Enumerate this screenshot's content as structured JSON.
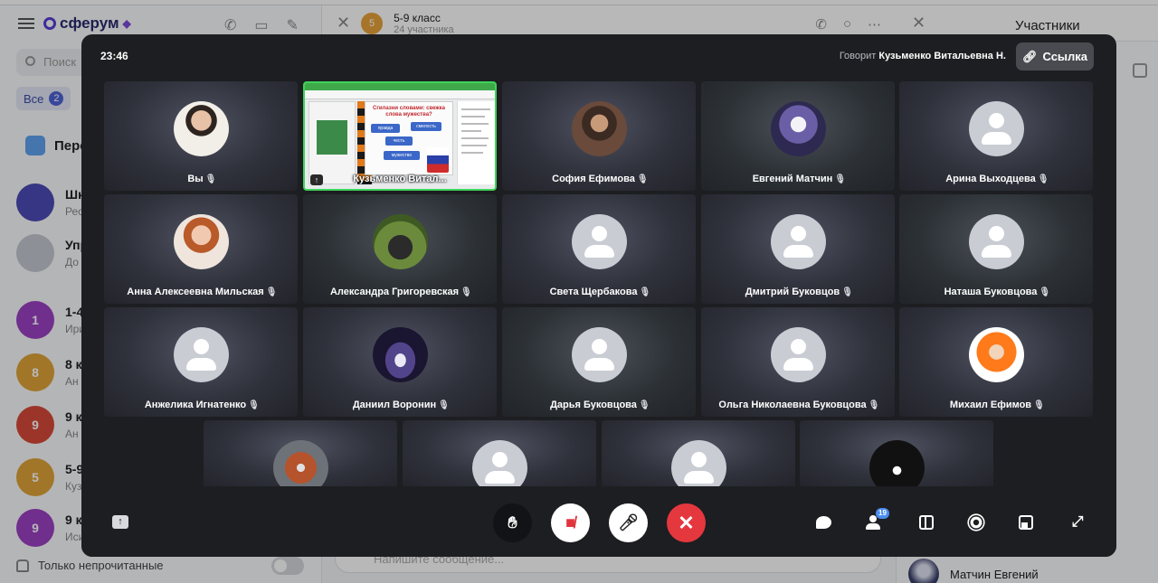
{
  "background_app": {
    "brand": "сферум",
    "search_placeholder": "Поиск",
    "filter_label": "Все",
    "filter_count": "2",
    "special_item": "Пере",
    "chats": [
      {
        "avatar": "",
        "title": "Шк",
        "sub": "Рес",
        "color": "#4d4bb8"
      },
      {
        "avatar": "",
        "title": "Упр",
        "sub": "До",
        "color": "#c4c8d0"
      },
      {
        "avatar": "1",
        "title": "1-4",
        "sub": "Ири",
        "color": "#9b40c4"
      },
      {
        "avatar": "8",
        "title": "8 к",
        "sub": "Ан",
        "color": "#e0a43a"
      },
      {
        "avatar": "9",
        "title": "9 к",
        "sub": "Ан",
        "color": "#d94a3a"
      },
      {
        "avatar": "5",
        "title": "5-9",
        "sub": "Куз",
        "color": "#e0a43a"
      },
      {
        "avatar": "9",
        "title": "9 к",
        "sub": "Иси",
        "color": "#9b40c4"
      }
    ],
    "unread_toggle_label": "Только непрочитанные",
    "chat_header_avatar": "5",
    "chat_header_title": "5-9 класс",
    "chat_header_sub": "24 участника",
    "message_placeholder": "Напишите сообщение...",
    "members_title": "Участники",
    "member_bottom": "Матчин Евгений"
  },
  "call": {
    "time": "23:46",
    "speaking_label": "Говорит",
    "speaking_name": "Кузьменко Витальевна Н.",
    "link_button": "Ссылка",
    "screen_share": {
      "name": "Кузьменко Витал...",
      "heading": "Сгилазни словами: свежка слова мужества?",
      "chips": [
        "правда",
        "смелость",
        "честь",
        "мужество"
      ]
    },
    "participants": [
      {
        "name": "Вы",
        "avatar": "photo-1"
      },
      {
        "name": "София Ефимова",
        "avatar": "photo-2"
      },
      {
        "name": "Евгений Матчин",
        "avatar": "photo-3"
      },
      {
        "name": "Арина Выходцева",
        "avatar": "default"
      },
      {
        "name": "Анна Алексеевна Мильская",
        "avatar": "photo-4"
      },
      {
        "name": "Александра Григоревская",
        "avatar": "photo-5"
      },
      {
        "name": "Света Щербакова",
        "avatar": "default"
      },
      {
        "name": "Дмитрий Буковцов",
        "avatar": "default"
      },
      {
        "name": "Наташа Буковцова",
        "avatar": "default"
      },
      {
        "name": "Анжелика Игнатенко",
        "avatar": "default"
      },
      {
        "name": "Даниил Воронин",
        "avatar": "photo-6"
      },
      {
        "name": "Дарья Буковцова",
        "avatar": "default"
      },
      {
        "name": "Ольга Николаевна Буковцова",
        "avatar": "default"
      },
      {
        "name": "Михаил Ефимов",
        "avatar": "photo-7"
      }
    ],
    "partial_row": [
      {
        "avatar": "photo-8"
      },
      {
        "avatar": "default"
      },
      {
        "avatar": "default"
      },
      {
        "avatar": "photo-9"
      }
    ],
    "participants_badge": "19",
    "icons": {
      "hand": "raise-hand-icon",
      "camera": "camera-off-icon",
      "mic": "mic-off-icon",
      "end": "end-call-icon",
      "chat": "chat-icon",
      "people": "participants-icon",
      "layout": "layout-icon",
      "settings": "gear-icon",
      "pip": "picture-in-picture-icon",
      "fullscreen": "fullscreen-icon"
    },
    "colors": {
      "end_call": "#e5373e",
      "active_speaker_border": "#3ed45a",
      "badge": "#4b8df0"
    }
  }
}
